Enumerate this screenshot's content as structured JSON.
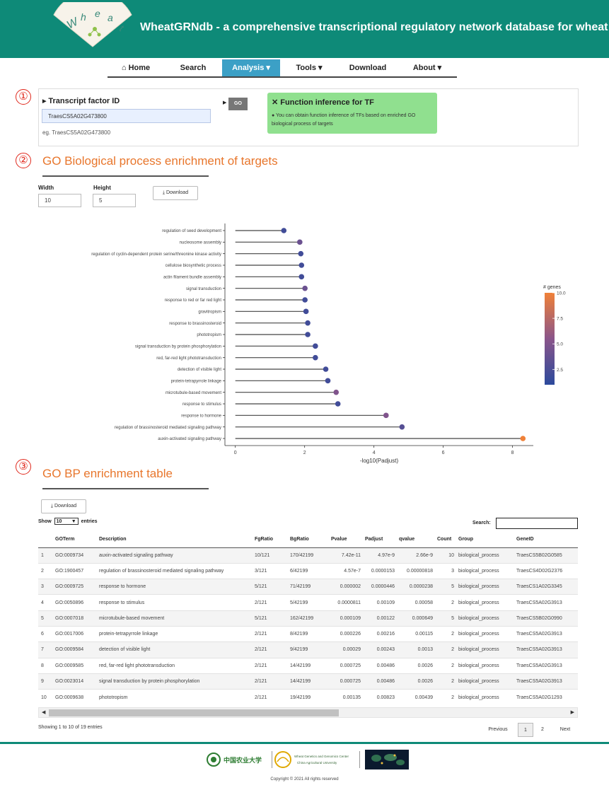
{
  "header": {
    "logo_letters": [
      "W",
      "h",
      "e",
      "a",
      "t"
    ],
    "title": "WheatGRNdb - a comprehensive transcriptional regulatory network database for wheat"
  },
  "nav": {
    "items": [
      {
        "label": "Home",
        "icon": "home-icon",
        "active": false
      },
      {
        "label": "Search",
        "active": false
      },
      {
        "label": "Analysis",
        "caret": true,
        "active": true
      },
      {
        "label": "Tools",
        "caret": true,
        "active": false
      },
      {
        "label": "Download",
        "active": false
      },
      {
        "label": "About",
        "caret": true,
        "active": false
      }
    ]
  },
  "section_markers": [
    "①",
    "②",
    "③"
  ],
  "tf_panel": {
    "label": "Transcript factor ID",
    "input_value": "TraesCS5A02G473800",
    "example": "eg. TraesCS5A02G473800",
    "go_label": "GO",
    "fn_title": "Function inference for TF",
    "fn_desc": "You can obtain function inference of TFs based on enriched GO biological process of targets"
  },
  "section2": {
    "title": "GO Biological process enrichment of targets",
    "width_label": "Width",
    "width_value": "10",
    "height_label": "Height",
    "height_value": "5",
    "download_label": "Download"
  },
  "chart_data": {
    "type": "scatter",
    "style": "lollipop",
    "categories": [
      "regulation of seed development",
      "nucleosome assembly",
      "regulation of cyclin-dependent protein serine/threonine kinase activity",
      "cellulose biosynthetic process",
      "actin filament bundle assembly",
      "signal transduction",
      "response to red or far red light",
      "gravitropism",
      "response to brassinosteroid",
      "phototropism",
      "signal transduction by protein phosphorylation",
      "red, far-red light phototransduction",
      "detection of visible light",
      "protein-tetrapyrrole linkage",
      "microtubule-based movement",
      "response to stimulus",
      "response to hormone",
      "regulation of brassinosteroid mediated signaling pathway",
      "auxin-activated signaling pathway"
    ],
    "values": [
      1.4,
      1.86,
      1.89,
      1.91,
      1.91,
      2.01,
      2.01,
      2.04,
      2.09,
      2.09,
      2.31,
      2.31,
      2.61,
      2.67,
      2.91,
      2.96,
      4.35,
      4.81,
      8.3
    ],
    "color_values": [
      2,
      4,
      2,
      2,
      2,
      4,
      2,
      2,
      2,
      2,
      2,
      2,
      2,
      2,
      5,
      2,
      5,
      3,
      10
    ],
    "xlabel": "-log10(Padjust)",
    "xticks": [
      0,
      2,
      4,
      6,
      8
    ],
    "xlim": [
      -0.3,
      8.6
    ],
    "legend_title": "# genes",
    "legend_ticks": [
      2.5,
      5.0,
      7.5,
      10.0
    ],
    "legend_tick_labels": [
      "2.5",
      "5.0",
      "7.5",
      "10.0"
    ],
    "color_range": [
      1,
      10
    ],
    "color_low": "#2c4a9c",
    "color_high": "#f08138",
    "legend_position": "right"
  },
  "section3": {
    "title": "GO BP enrichment table",
    "download_label": "Download",
    "show_label": "Show",
    "show_value": "10",
    "entries_label": "entries",
    "search_label": "Search:",
    "columns": [
      "",
      "GOTerm",
      "Description",
      "FgRatio",
      "BgRatio",
      "Pvalue",
      "Padjust",
      "qvalue",
      "Count",
      "Group",
      "GeneID"
    ],
    "rows": [
      [
        "1",
        "GO:0009734",
        "auxin-activated signaling pathway",
        "10/121",
        "170/42199",
        "7.42e-11",
        "4.97e-9",
        "2.66e-9",
        "10",
        "biological_process",
        "TraesCS5B02G0585"
      ],
      [
        "2",
        "GO:1900457",
        "regulation of brassinosteroid mediated signaling pathway",
        "3/121",
        "6/42199",
        "4.57e-7",
        "0.0000153",
        "0.00000818",
        "3",
        "biological_process",
        "TraesCS4D02G2376"
      ],
      [
        "3",
        "GO:0009725",
        "response to hormone",
        "5/121",
        "71/42199",
        "0.000002",
        "0.0000446",
        "0.0000238",
        "5",
        "biological_process",
        "TraesCS1A02G3345"
      ],
      [
        "4",
        "GO:0050896",
        "response to stimulus",
        "2/121",
        "5/42199",
        "0.0000811",
        "0.00109",
        "0.00058",
        "2",
        "biological_process",
        "TraesCS5A02G3913"
      ],
      [
        "5",
        "GO:0007018",
        "microtubule-based movement",
        "5/121",
        "162/42199",
        "0.000109",
        "0.00122",
        "0.000649",
        "5",
        "biological_process",
        "TraesCS5B02G0990"
      ],
      [
        "6",
        "GO:0017006",
        "protein-tetrapyrrole linkage",
        "2/121",
        "8/42199",
        "0.000226",
        "0.00216",
        "0.00115",
        "2",
        "biological_process",
        "TraesCS5A02G3913"
      ],
      [
        "7",
        "GO:0009584",
        "detection of visible light",
        "2/121",
        "9/42199",
        "0.00029",
        "0.00243",
        "0.0013",
        "2",
        "biological_process",
        "TraesCS5A02G3913"
      ],
      [
        "8",
        "GO:0009585",
        "red, far-red light phototransduction",
        "2/121",
        "14/42199",
        "0.000725",
        "0.00486",
        "0.0026",
        "2",
        "biological_process",
        "TraesCS5A02G3913"
      ],
      [
        "9",
        "GO:0023014",
        "signal transduction by protein phosphorylation",
        "2/121",
        "14/42199",
        "0.000725",
        "0.00486",
        "0.0026",
        "2",
        "biological_process",
        "TraesCS5A02G3913"
      ],
      [
        "10",
        "GO:0009638",
        "phototropism",
        "2/121",
        "19/42199",
        "0.00135",
        "0.00823",
        "0.00439",
        "2",
        "biological_process",
        "TraesCS5A02G1293"
      ]
    ],
    "info": "Showing 1 to 10 of 19 entries",
    "pager": {
      "previous": "Previous",
      "pages": [
        "1",
        "2"
      ],
      "current": "1",
      "next": "Next"
    }
  },
  "footer": {
    "logo1_text": "中国农业大学",
    "logo2_text": "Wheat Genetics and Genomics Center",
    "logo2_sub": "China Agricultural University",
    "copyright": "Copyright © 2021 All rights reserved"
  }
}
